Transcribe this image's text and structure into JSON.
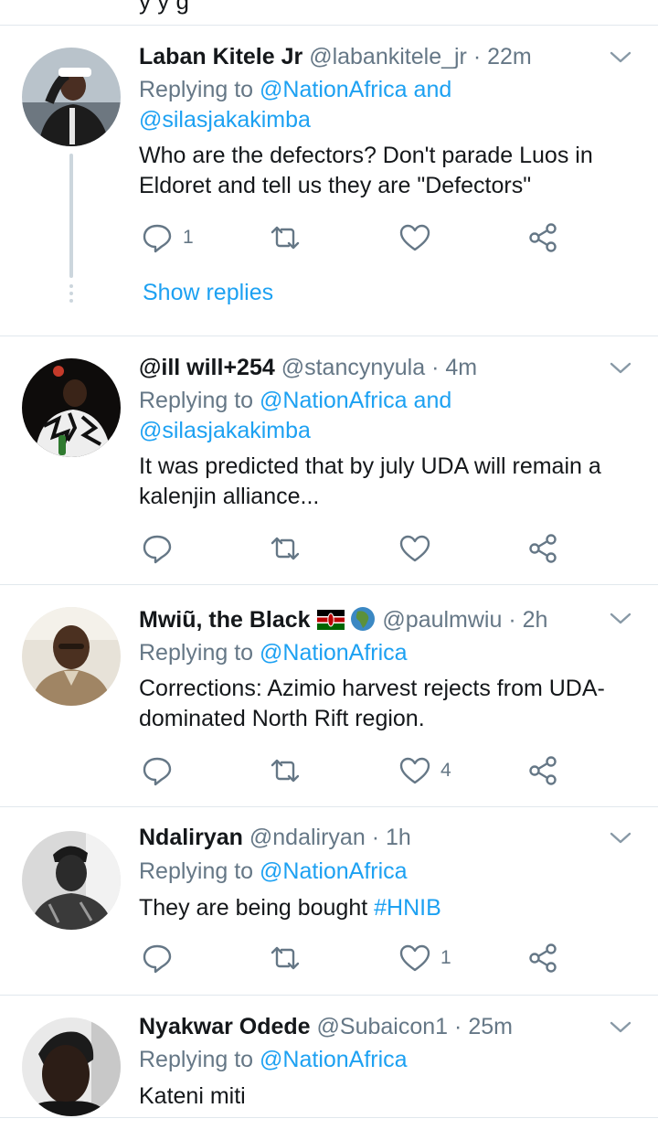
{
  "colors": {
    "accent": "#1da1f2",
    "muted": "#657786",
    "text": "#14171a",
    "divider": "#e1e8ed"
  },
  "top_cut_text": "y                             y              g",
  "tweets": [
    {
      "name": "Laban Kitele Jr",
      "handle": "@labankitele_jr",
      "time": "22m",
      "replying_prefix": "Replying to",
      "mentions": [
        "@NationAfrica",
        "and",
        "@silasjakakimba"
      ],
      "text": "Who are the defectors? Don't parade Luos in Eldoret and tell us they are \"Defectors\"",
      "reply_count": "1",
      "retweet_count": "",
      "like_count": "",
      "show_replies": "Show replies"
    },
    {
      "name": "@ill will+254",
      "handle": "@stancynyula",
      "time": "4m",
      "replying_prefix": "Replying to",
      "mentions": [
        "@NationAfrica",
        "and",
        "@silasjakakimba"
      ],
      "text": "It was predicted that by july UDA will remain a kalenjin alliance...",
      "reply_count": "",
      "retweet_count": "",
      "like_count": ""
    },
    {
      "name": "Mwiũ, the Black",
      "name_emoji": [
        "kenya-flag",
        "globe-africa"
      ],
      "handle": "@paulmwiu",
      "time": "2h",
      "replying_prefix": "Replying to",
      "mentions": [
        "@NationAfrica"
      ],
      "text": "Corrections: Azimio harvest rejects from UDA-dominated North Rift region.",
      "reply_count": "",
      "retweet_count": "",
      "like_count": "4"
    },
    {
      "name": "Ndaliryan",
      "handle": "@ndaliryan",
      "time": "1h",
      "replying_prefix": "Replying to",
      "mentions": [
        "@NationAfrica"
      ],
      "text": "They are being bought ",
      "hashtag": "#HNIB",
      "reply_count": "",
      "retweet_count": "",
      "like_count": "1"
    },
    {
      "name": "Nyakwar Odede",
      "handle": "@Subaicon1",
      "time": "25m",
      "replying_prefix": "Replying to",
      "mentions": [
        "@NationAfrica"
      ],
      "text": "Kateni miti"
    }
  ],
  "separator": "·"
}
